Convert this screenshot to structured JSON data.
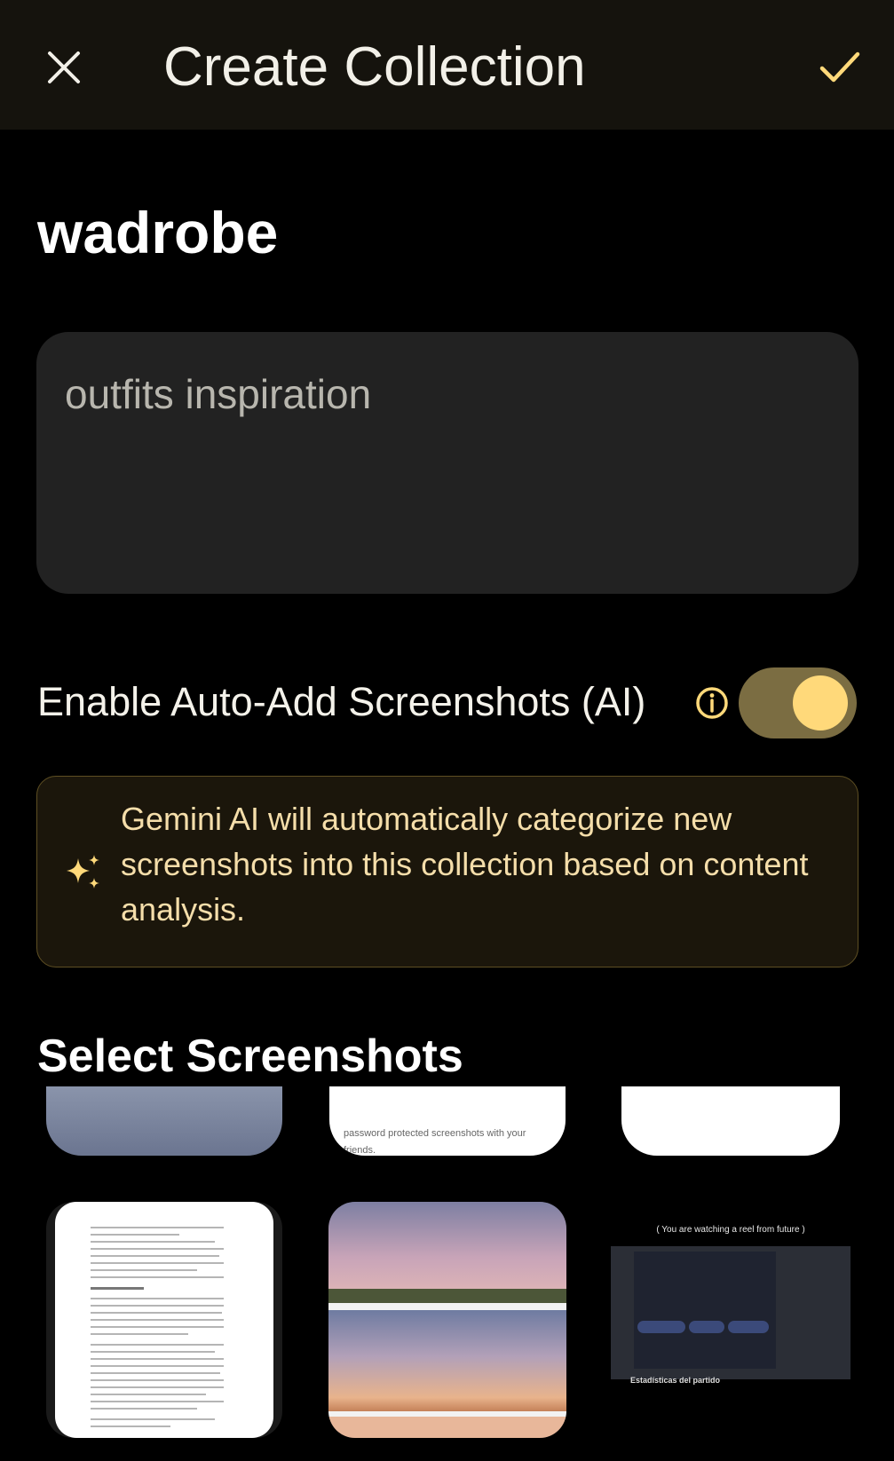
{
  "appbar": {
    "title": "Create Collection",
    "close_icon": "close-icon",
    "confirm_icon": "check-icon"
  },
  "collection": {
    "name": "wadrobe",
    "description": "outfits inspiration"
  },
  "auto_add": {
    "label": "Enable Auto-Add Screenshots (AI)",
    "enabled": true,
    "info_icon": "info-icon"
  },
  "info_card": {
    "icon": "sparkle-icon",
    "text": "Gemini AI will automatically categorize new screenshots into this collection based on content analysis."
  },
  "screenshots": {
    "title": "Select Screenshots",
    "items": [
      {
        "kind": "sky-photo"
      },
      {
        "kind": "text",
        "text": "password protected screenshots with your friends."
      },
      {
        "kind": "blank"
      },
      {
        "kind": "document"
      },
      {
        "kind": "sunset-photos"
      },
      {
        "kind": "video",
        "caption": "( You are watching a reel from future )",
        "footer": "Estadísticas del partido"
      }
    ]
  },
  "colors": {
    "accent": "#ffd97a",
    "appbar_bg": "#15130d",
    "info_card_bg": "#1b160b",
    "info_text": "#f5deaa"
  }
}
